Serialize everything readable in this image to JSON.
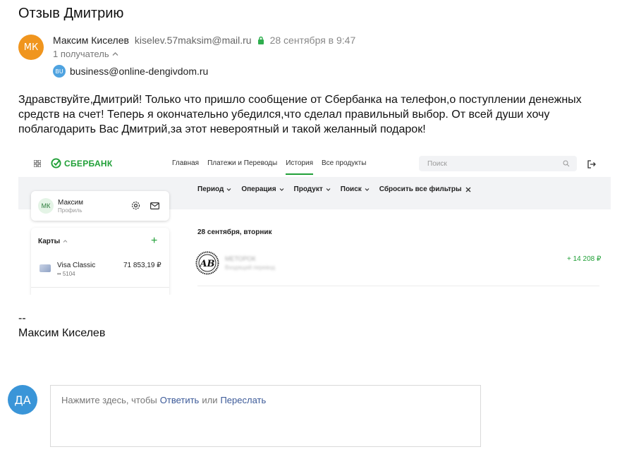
{
  "email": {
    "subject": "Отзыв Дмитрию",
    "sender": {
      "initials": "МК",
      "name": "Максим Киселев",
      "email": "kiselev.57maksim@mail.ru",
      "date": "28 сентября в 9:47",
      "avatar_color": "#f0951e"
    },
    "recipients_count": "1 получатель",
    "recipient": {
      "initials": "BU",
      "email": "business@online-dengivdom.ru"
    },
    "body": "Здравствуйте,Дмитрий! Только что пришло сообщение от Сбербанка на телефон,о поступлении денежных средств на счет! Теперь я окончательно убедился,что сделал правильный выбор. От всей души хочу поблагодарить Вас Дмитрий,за этот невероятный и такой желанный подарок!",
    "signature_dash": "--",
    "signature_name": "Максим Киселев"
  },
  "sber": {
    "logo_text": "СБЕРБАНК",
    "nav": [
      "Главная",
      "Платежи и Переводы",
      "История",
      "Все продукты"
    ],
    "nav_active_index": 2,
    "search_placeholder": "Поиск",
    "filters": [
      "Период",
      "Операция",
      "Продукт",
      "Поиск"
    ],
    "reset_filters": "Сбросить все фильтры",
    "profile": {
      "initials": "МК",
      "name": "Максим",
      "sub": "Профиль"
    },
    "cards": {
      "title": "Карты",
      "add": "+",
      "card_name": "Visa Classic",
      "card_number": "•• 5104",
      "card_balance": "71 853,19 ₽"
    },
    "day_title": "28 сентября, вторник",
    "transaction": {
      "name": "МЕТОРОК",
      "sub": "Входящий перевод",
      "amount": "+ 14 208 ₽"
    },
    "brand_color": "#21a038"
  },
  "reply": {
    "initials": "ДА",
    "prompt_prefix": "Нажмите здесь, чтобы",
    "reply_link": "Ответить",
    "or_text": "или",
    "forward_link": "Переслать"
  }
}
